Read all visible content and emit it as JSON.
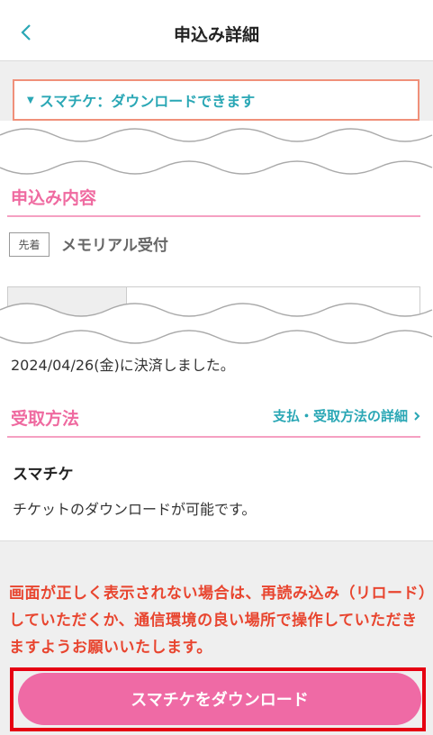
{
  "header": {
    "title": "申込み詳細",
    "back_icon": "chevron-left-icon"
  },
  "banner": {
    "marker": "▼",
    "text": "スマチケ：ダウンロードできます"
  },
  "application": {
    "section_title": "申込み内容",
    "badge": "先着",
    "name": "メモリアル受付",
    "settlement": "2024/04/26(金)に決済しました。"
  },
  "receipt": {
    "section_title": "受取方法",
    "detail_link": "支払・受取方法の詳細",
    "method_name": "スマチケ",
    "method_desc": "チケットのダウンロードが可能です。"
  },
  "notice": "画面が正しく表示されない場合は、再読み込み（リロード）していただくか、通信環境の良い場所で操作していただきますようお願いいたします。",
  "download_button": "スマチケをダウンロード",
  "colors": {
    "accent_pink": "#ef6aa5",
    "teal": "#2aa7b5",
    "warning_red": "#e8452f",
    "highlight_red": "#e60012"
  }
}
